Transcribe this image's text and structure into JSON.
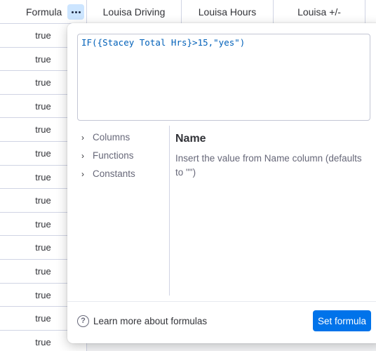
{
  "header": {
    "formula_label": "Formula",
    "columns": [
      "Louisa Driving",
      "Louisa Hours",
      "Louisa +/-"
    ]
  },
  "rows": [
    "true",
    "true",
    "true",
    "true",
    "true",
    "true",
    "true",
    "true",
    "true",
    "true",
    "true",
    "true",
    "true",
    "true"
  ],
  "popup": {
    "formula_text": "IF({Stacey Total Hrs}>15,\"yes\")",
    "side_items": [
      "Columns",
      "Functions",
      "Constants"
    ],
    "info_title": "Name",
    "info_desc": "Insert the value from Name column (defaults to \"\")",
    "help_link": "Learn more about formulas",
    "help_icon": "?",
    "set_button": "Set formula"
  },
  "colors": {
    "accent": "#0073ea",
    "formula_text": "#0060b9",
    "more_button_bg": "#cce5ff"
  }
}
